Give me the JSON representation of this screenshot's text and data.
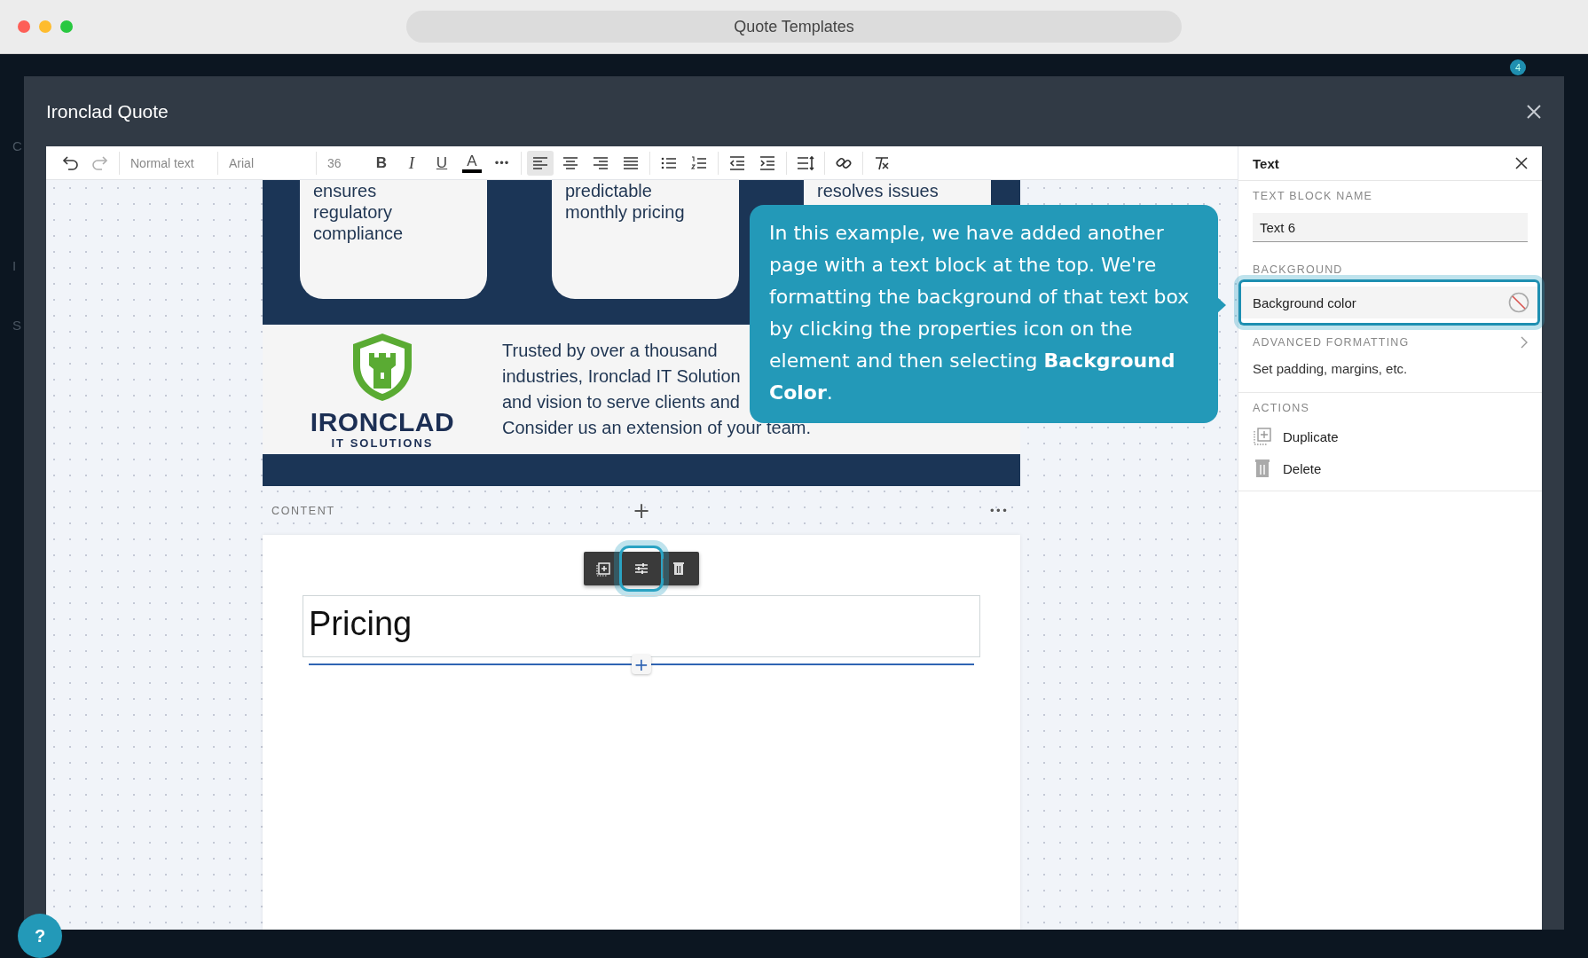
{
  "window": {
    "title": "Quote Templates"
  },
  "app_background": {
    "sidebar_letters": [
      "C",
      "I",
      "S"
    ],
    "notification_count": "4"
  },
  "modal": {
    "title": "Ironclad Quote"
  },
  "toolbar": {
    "history": [
      {
        "kind": "undo",
        "disabled": false
      },
      {
        "kind": "redo",
        "disabled": true
      }
    ],
    "paragraph_style": "Normal text",
    "font": "Arial",
    "font_size": "36",
    "formatting": [
      {
        "kind": "bold",
        "label": "B"
      },
      {
        "kind": "italic",
        "label": "I"
      },
      {
        "kind": "underline",
        "label": "U"
      },
      {
        "kind": "color",
        "label": "A"
      }
    ],
    "more": "•••",
    "alignment": [
      {
        "kind": "left",
        "selected": true
      },
      {
        "kind": "center",
        "selected": false
      },
      {
        "kind": "right",
        "selected": false
      },
      {
        "kind": "justify",
        "selected": false
      }
    ],
    "tool_groups": [
      [
        {
          "kind": "bulleted-list"
        },
        {
          "kind": "numbered-list"
        }
      ],
      [
        {
          "kind": "outdent"
        },
        {
          "kind": "indent"
        }
      ],
      [
        {
          "kind": "line-spacing"
        }
      ],
      [
        {
          "kind": "link"
        }
      ],
      [
        {
          "kind": "clear-formatting"
        }
      ]
    ]
  },
  "document": {
    "cards": [
      {
        "lines": [
          "ensures",
          "regulatory",
          "compliance"
        ]
      },
      {
        "lines": [
          "predictable",
          "monthly pricing"
        ]
      },
      {
        "lines": [
          "resolves issues"
        ]
      }
    ],
    "logo": {
      "name": "IRONCLAD",
      "tagline": "IT SOLUTIONS"
    },
    "about_lines": [
      "Trusted by over a thousand",
      "industries, Ironclad IT Solution",
      "and vision to serve clients and",
      "Consider us an extension of your team."
    ],
    "section": {
      "label": "CONTENT",
      "add": "+",
      "more": "•••"
    },
    "block_toolbar": [
      {
        "kind": "duplicate",
        "highlighted": false
      },
      {
        "kind": "properties",
        "highlighted": true
      },
      {
        "kind": "delete",
        "highlighted": false
      }
    ],
    "text_block": {
      "text": "Pricing",
      "insert": "+"
    }
  },
  "callout": {
    "text": "In this example, we have added another page with a text block at the top. We're formatting the background of that text box by clicking the properties icon on the element and then selecting **Background Color**."
  },
  "panel": {
    "title": "Text",
    "name_label": "TEXT BLOCK NAME",
    "name_value": "Text 6",
    "background_label": "BACKGROUND",
    "background_option": {
      "label": "Background color",
      "highlighted": true
    },
    "advanced_label": "ADVANCED FORMATTING",
    "advanced_hint": "Set padding, margins, etc.",
    "actions_label": "ACTIONS",
    "actions": [
      {
        "kind": "duplicate",
        "label": "Duplicate"
      },
      {
        "kind": "delete",
        "label": "Delete"
      }
    ]
  },
  "help": {
    "label": "?"
  }
}
